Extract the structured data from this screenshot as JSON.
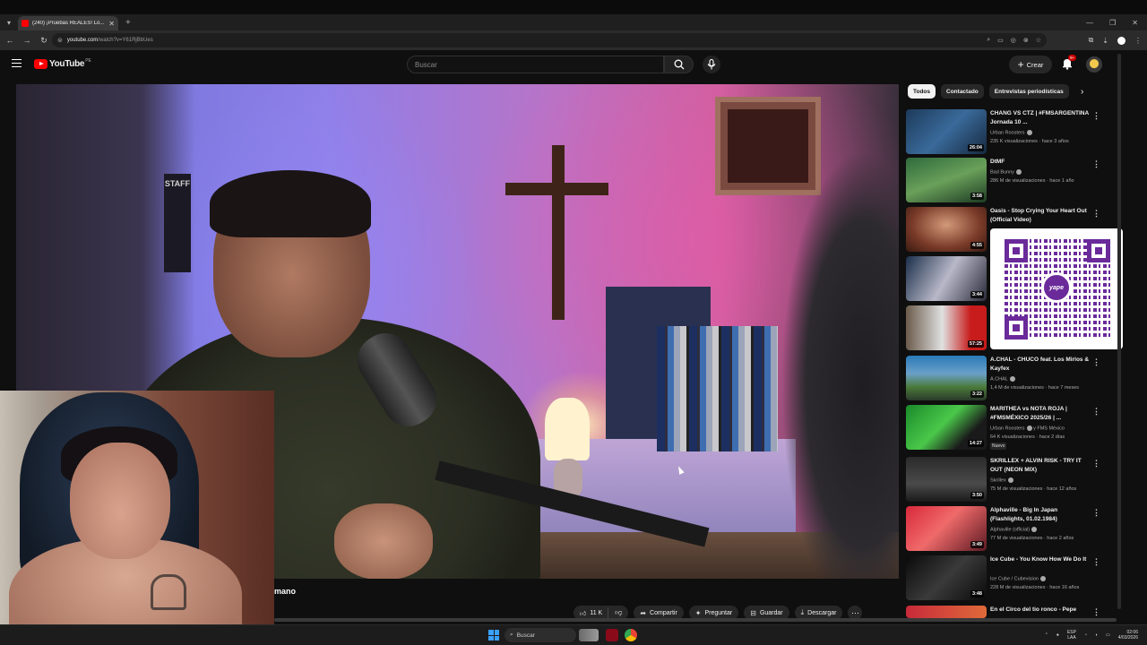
{
  "browser": {
    "tab_title": "(240) ¡Pruebas REALES! Lo...",
    "url_host": "youtube.com",
    "url_path": "/watch?v=Y61RjBbUes"
  },
  "youtube": {
    "logo_text": "YouTube",
    "country_code": "PE",
    "search_placeholder": "Buscar",
    "create_label": "Crear",
    "notification_count": "9+"
  },
  "video": {
    "subtitle_fragment": "mano",
    "backdrop_sign": "STAFF"
  },
  "actions": {
    "like_count": "11 K",
    "share": "Compartir",
    "ask": "Preguntar",
    "save": "Guardar",
    "download": "Descargar"
  },
  "sidebar": {
    "chips": [
      "Todos",
      "Contactado",
      "Entrevistas periodísticas"
    ],
    "recommendations": [
      {
        "title": "CHANG VS CTZ | #FMSARGENTINA Jornada 10 ...",
        "channel": "Urban Roosters",
        "meta": "235 K visualizaciones · hace 3 años",
        "duration": "26:04"
      },
      {
        "title": "DtMF",
        "channel": "Bad Bunny",
        "meta": "286 M de visualizaciones · hace 1 año",
        "duration": "3:58"
      },
      {
        "title": "Oasis - Stop Crying Your Heart Out (Official Video)",
        "channel": "",
        "meta": "",
        "duration": "4:55"
      },
      {
        "title": "",
        "channel": "",
        "meta": "",
        "duration": "3:44"
      },
      {
        "title": "",
        "channel": "",
        "meta": "",
        "duration": "57:25"
      },
      {
        "title": "A.CHAL - CHUCO feat. Los Mirlos & Kayfex",
        "channel": "A.CHAL",
        "meta": "1,4 M de visualizaciones · hace 7 meses",
        "duration": "3:22"
      },
      {
        "title": "MARITHEA vs NOTA ROJA | #FMSMÉXICO 2025/26 | ...",
        "channel": "Urban Roosters",
        "channel_extra": "y FMS México",
        "meta": "64 K visualizaciones · hace 2 días",
        "badge": "Nuevo",
        "duration": "14:27"
      },
      {
        "title": "SKRILLEX + ALVIN RISK - TRY IT OUT (NEON MIX)",
        "channel": "Skrillex",
        "meta": "75 M de visualizaciones · hace 12 años",
        "duration": "3:50"
      },
      {
        "title": "Alphaville - Big In Japan (Flashlights, 01.02.1984)",
        "channel": "Alphaville (official)",
        "meta": "77 M de visualizaciones · hace 2 años",
        "duration": "3:49"
      },
      {
        "title": "Ice Cube - You Know How We Do It",
        "channel": "Ice Cube / Cubevision",
        "meta": "228 M de visualizaciones · hace 16 años",
        "duration": "3:48"
      },
      {
        "title": "En el Circo del tio ronco - Pepe",
        "channel": "",
        "meta": "",
        "duration": ""
      }
    ]
  },
  "overlay": {
    "qr_brand": "yape"
  },
  "taskbar": {
    "search": "Buscar",
    "lang_line1": "ESP",
    "lang_line2": "LAA",
    "time": "02:06",
    "date": "4/03/2026"
  },
  "colors": {
    "yt_red": "#ff0000",
    "qr_purple": "#6a2a9a",
    "background": "#0f0f0f"
  }
}
